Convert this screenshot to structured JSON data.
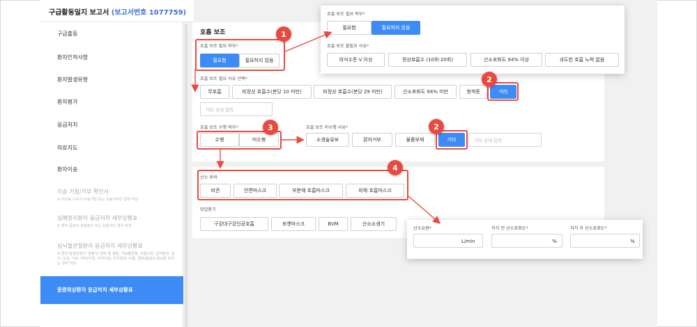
{
  "header": {
    "title": "구급활동일지 보고서",
    "report_id": "(보고서번호 1077759)"
  },
  "sidebar": {
    "items": [
      {
        "label": "구급출동"
      },
      {
        "label": "환자인적사항"
      },
      {
        "label": "환자발생유형"
      },
      {
        "label": "환자평가"
      },
      {
        "label": "응급처치"
      },
      {
        "label": "의료지도"
      },
      {
        "label": "환자이송"
      },
      {
        "label": "이송 거절/거부 확인서",
        "sub": "※ 미이송 사유가 이송거절 또는 이송거부인 경우 작성"
      },
      {
        "label": "심폐정지환자 응급처치 세부상황표",
        "sub": "※ 환자 증상이 호흡정지 또는 심정지인 경우 작성"
      },
      {
        "label": "심뇌혈관질환자 응급처치 세부상황표",
        "sub": "※ 환자 발생유형이 '질병'인 환자 중 흉통, 가슴불편함, 호흡곤란, 심계항진, 실신, 오심, 구토, 마비/이완, 어지러움, 의식장애, 두통, 경련/떨림의 증상을 보이는 경우 작성"
      }
    ],
    "active_label": "중증외상환자 응급처치 세부상황표"
  },
  "section": {
    "title": "호흡 보조"
  },
  "respiration_needed": {
    "label": "호흡 보조 필요 여부",
    "required_mark": "*",
    "options": [
      "필요함",
      "필요하지 않음"
    ],
    "selected": "필요함"
  },
  "respiration_reason": {
    "label": "호흡 보조 필요 사유 선택",
    "required_mark": "*",
    "options": [
      "무호흡",
      "비정상 호흡수(분당 10 미만)",
      "비정상 호흡수(분당 29 미만)",
      "산소포화도 94% 미만",
      "청색증",
      "기타"
    ],
    "selected": "기타",
    "detail_placeholder": "기타 상세 입력"
  },
  "respiration_done": {
    "label": "호흡 보조 수행 여부",
    "required_mark": "*",
    "options": [
      "수행",
      "미수행"
    ]
  },
  "not_done_reason": {
    "label": "호흡 보조 미수행 사유",
    "required_mark": "*",
    "options": [
      "소생술유보",
      "환자거부",
      "물품부재",
      "기타"
    ],
    "selected": "기타",
    "detail_placeholder": "기타 상세 입력"
  },
  "oxygen": {
    "label": "산소 투여",
    "options": [
      "비관",
      "안면마스크",
      "부분재 호흡마스크",
      "비재 호흡마스크"
    ]
  },
  "airway": {
    "label": "양압환기",
    "options": [
      "구강대구강인공호흡",
      "포켓마스크",
      "BVM",
      "산소소생기"
    ]
  },
  "popup_top": {
    "needed_label": "호흡 보조 필요 여부",
    "needed_options": [
      "필요함",
      "필요하지 않음"
    ],
    "needed_selected": "필요하지 않음",
    "reason_label": "호흡 보조 불필요 사유",
    "reason_options": [
      "의식수준 V 이상",
      "정상호흡수 (10회-20회)",
      "산소포화도 94% 이상",
      "과도한 호흡 노력 없음"
    ],
    "required_mark": "*"
  },
  "popup_bottom": {
    "flow_label": "산소유량",
    "flow_unit": "L/min",
    "before_label": "처치 전 산소포화도",
    "before_unit": "%",
    "after_label": "처치 후 산소포화도",
    "after_unit": "%",
    "required_mark": "*"
  },
  "badges": [
    "1",
    "2",
    "2",
    "3",
    "4"
  ],
  "colors": {
    "accent": "#3d8bf5",
    "highlight": "#e9493f",
    "report_id": "#3a6fd8"
  }
}
